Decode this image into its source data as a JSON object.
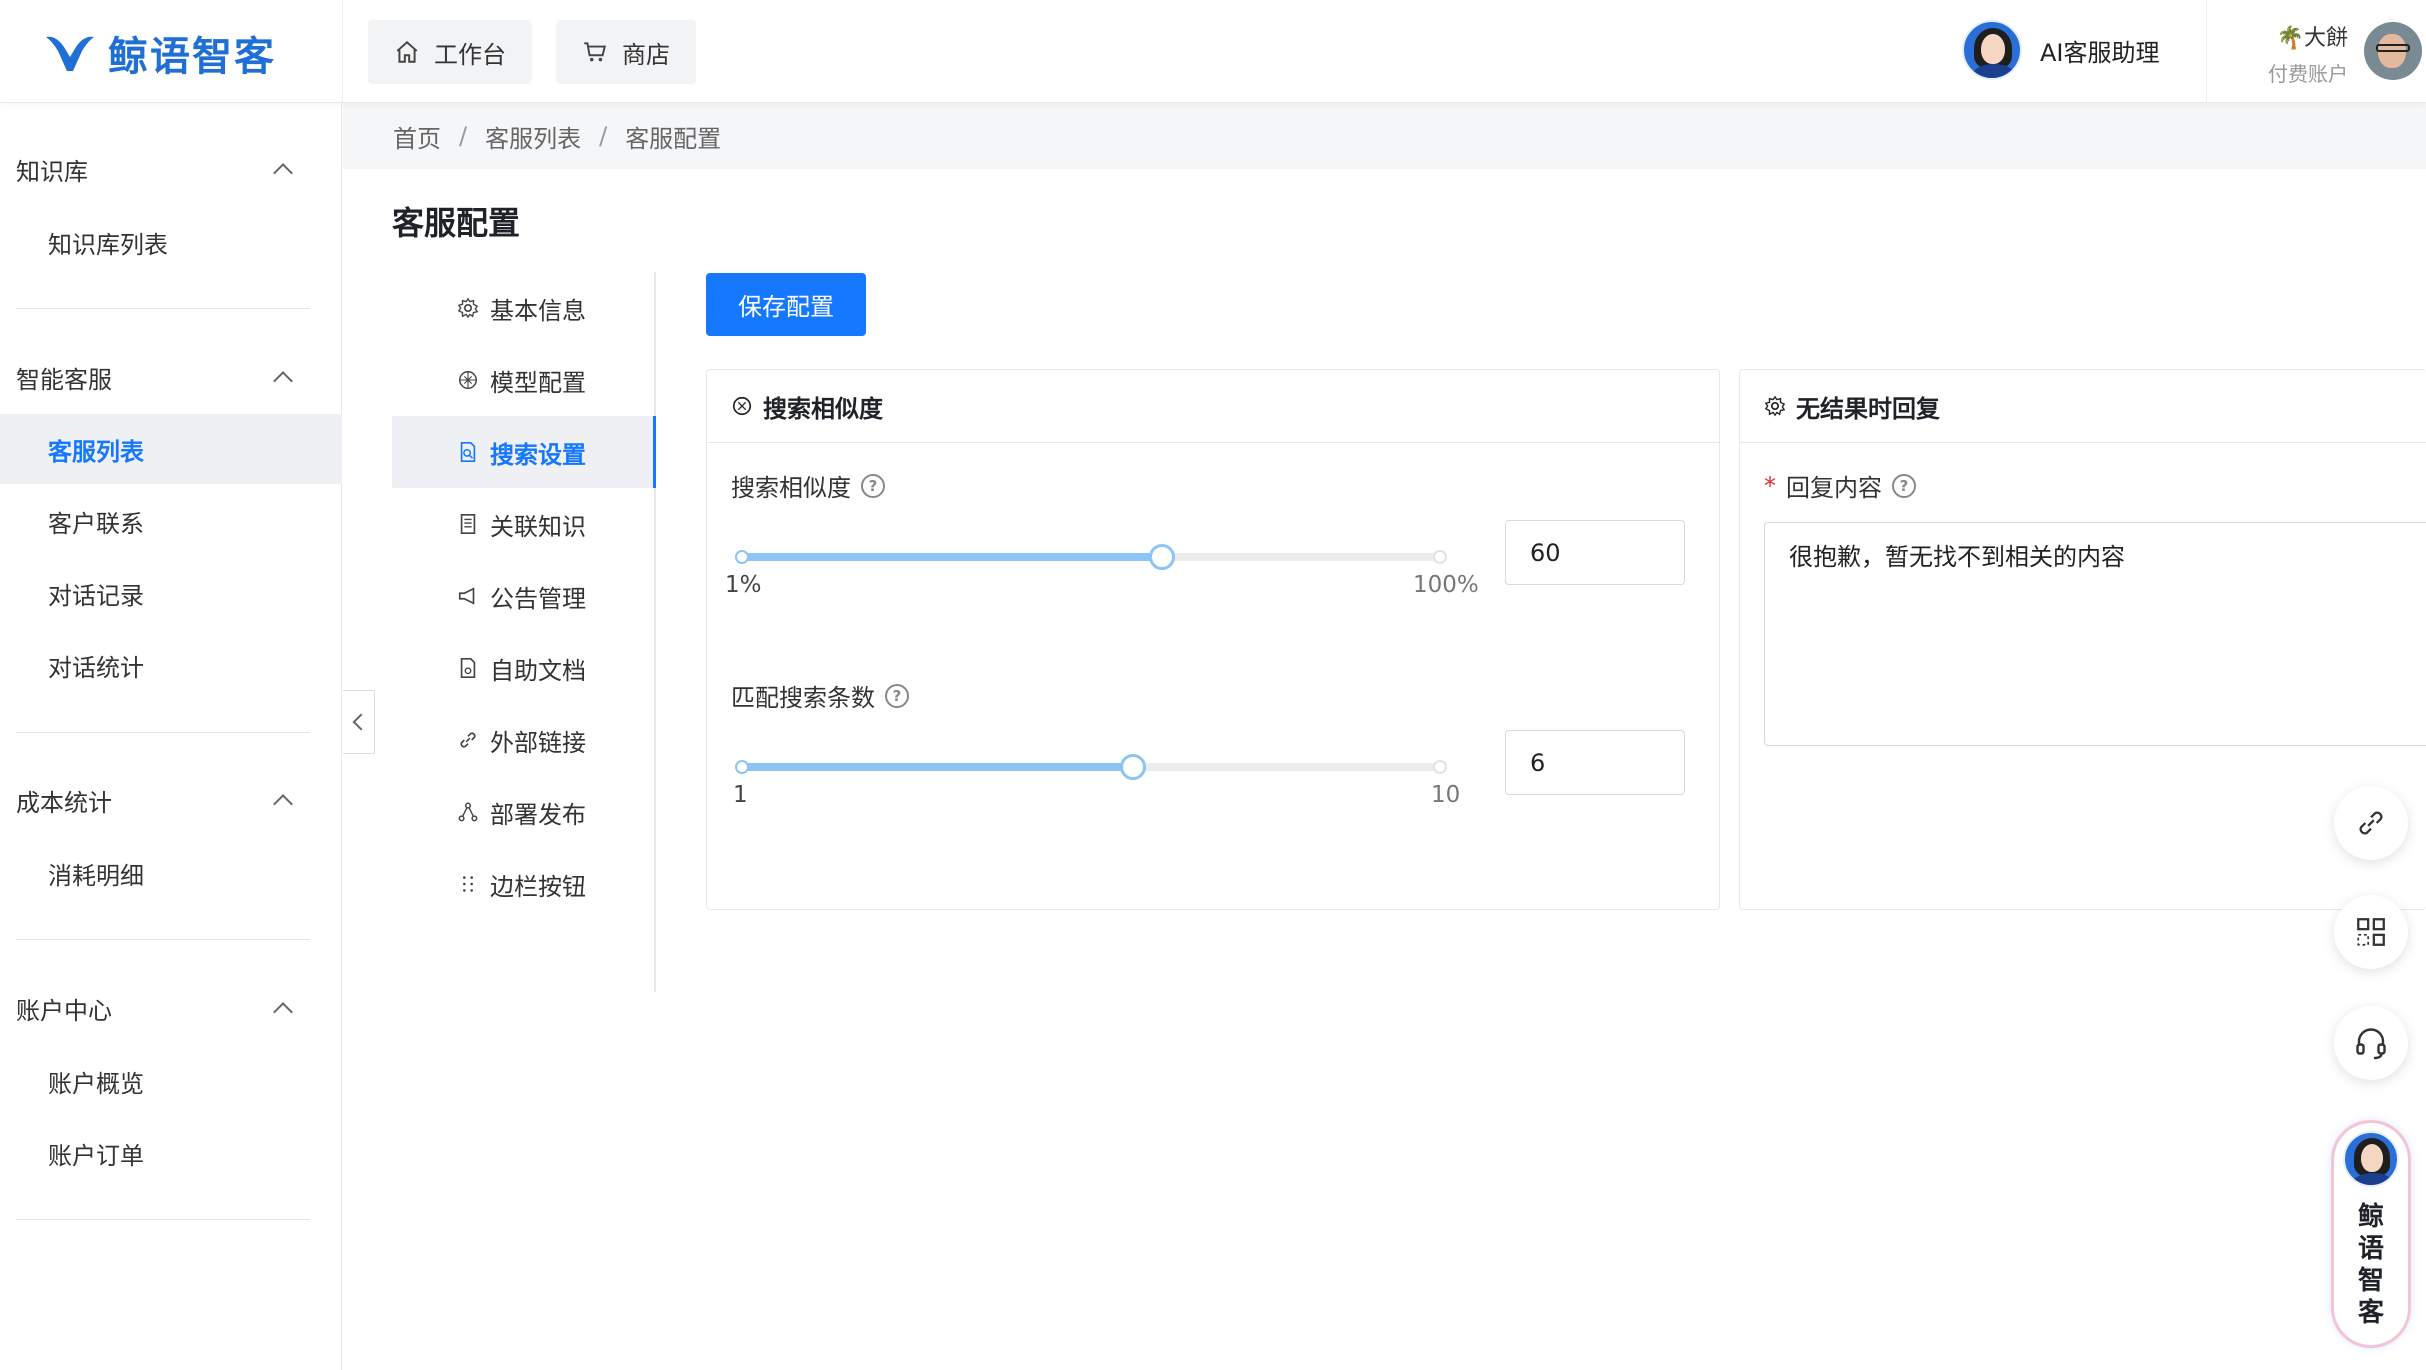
{
  "brand": {
    "name": "鲸语智客"
  },
  "topbar": {
    "workbench_label": "工作台",
    "store_label": "商店",
    "assistant_label": "AI客服助理",
    "user_name": "🌴大餅",
    "user_plan": "付费账户"
  },
  "sidebar": {
    "groups": [
      {
        "title": "知识库",
        "items": [
          "知识库列表"
        ]
      },
      {
        "title": "智能客服",
        "items": [
          "客服列表",
          "客户联系",
          "对话记录",
          "对话统计"
        ]
      },
      {
        "title": "成本统计",
        "items": [
          "消耗明细"
        ]
      },
      {
        "title": "账户中心",
        "items": [
          "账户概览",
          "账户订单"
        ]
      }
    ],
    "active_item": "客服列表"
  },
  "breadcrumb": [
    "首页",
    "客服列表",
    "客服配置"
  ],
  "page_title": "客服配置",
  "submenu": {
    "items": [
      "基本信息",
      "模型配置",
      "搜索设置",
      "关联知识",
      "公告管理",
      "自助文档",
      "外部链接",
      "部署发布",
      "边栏按钮"
    ],
    "active": "搜索设置"
  },
  "save_button": "保存配置",
  "similarity_card": {
    "title": "搜索相似度",
    "similarity": {
      "label": "搜索相似度",
      "min_label": "1%",
      "max_label": "100%",
      "min": 1,
      "max": 100,
      "value": "60"
    },
    "match_count": {
      "label": "匹配搜索条数",
      "min_label": "1",
      "max_label": "10",
      "min": 1,
      "max": 10,
      "value": "6"
    }
  },
  "no_result_card": {
    "title": "无结果时回复",
    "field_label": "回复内容",
    "required_mark": "*",
    "reply_text": "很抱歉，暂无找不到相关的内容"
  },
  "float_widget": {
    "brand_chars": [
      "鲸",
      "语",
      "智",
      "客"
    ]
  },
  "colors": {
    "primary": "#1677ff",
    "slider": "#8cc4f5",
    "logo": "#1f6fd6"
  }
}
